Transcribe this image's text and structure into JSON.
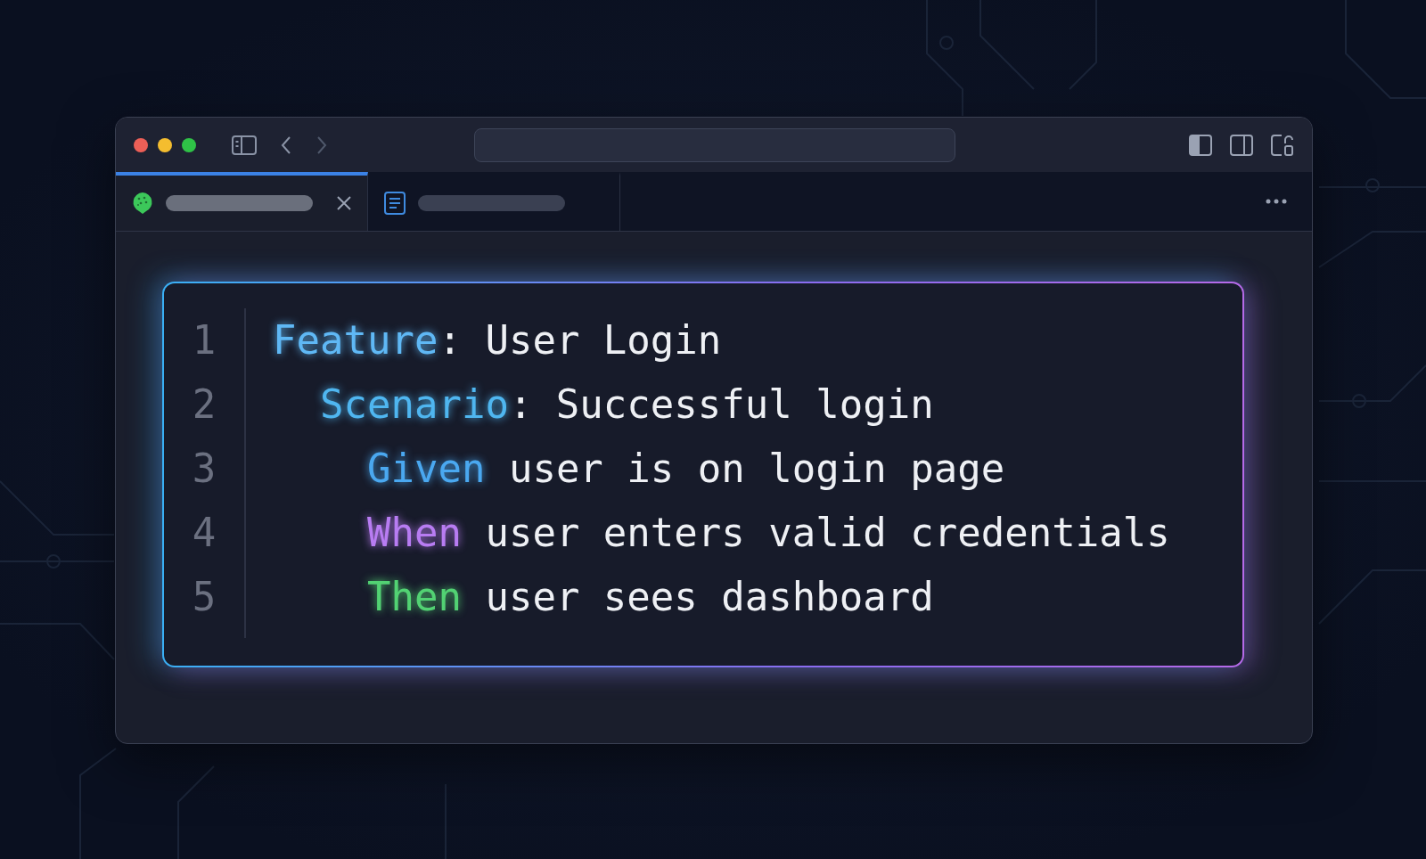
{
  "window": {
    "traffic_lights": [
      {
        "color": "#ec5f57"
      },
      {
        "color": "#f4bd2f"
      },
      {
        "color": "#2fc247"
      }
    ]
  },
  "tabs": [
    {
      "selected": true,
      "kind": "gherkin"
    },
    {
      "selected": false,
      "kind": "document"
    }
  ],
  "editor": {
    "lines": [
      {
        "number": "1",
        "keyword": "Feature",
        "text": ": User Login",
        "color": "#5fb8f5",
        "children": [
          {
            "number": "2",
            "keyword": "Scenario",
            "text": ": Successful login",
            "color": "#4fb6f0",
            "children": [
              {
                "number": "3",
                "keyword": "Given",
                "text": " user is on login page",
                "color": "#4aa8f0"
              },
              {
                "number": "4",
                "keyword": "When",
                "text": " user enters valid credentials",
                "color": "#b87cf2"
              },
              {
                "number": "5",
                "keyword": "Then",
                "text": " user sees dashboard",
                "color": "#52d273"
              }
            ]
          }
        ]
      }
    ]
  }
}
